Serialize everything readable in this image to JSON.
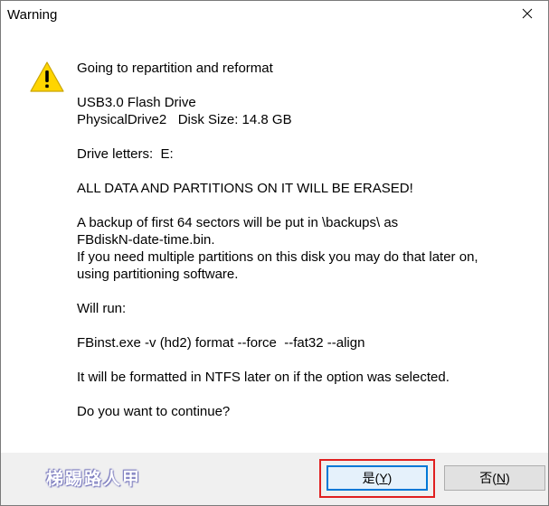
{
  "window": {
    "title": "Warning"
  },
  "icons": {
    "warning": "warning-icon",
    "close": "close-icon"
  },
  "colors": {
    "warning_yellow": "#ffd500",
    "highlight_red": "#e02020",
    "default_button_border": "#0078d7"
  },
  "message": {
    "line1": "Going to repartition and reformat",
    "line2": "USB3.0 Flash Drive",
    "line3": "PhysicalDrive2   Disk Size: 14.8 GB",
    "line4": "Drive letters:  E:",
    "line5": "ALL DATA AND PARTITIONS ON IT WILL BE ERASED!",
    "line6": "A backup of first 64 sectors will be put in \\backups\\ as",
    "line7": "FBdiskN-date-time.bin.",
    "line8": "If you need multiple partitions on this disk you may do that later on,",
    "line9": "using partitioning software.",
    "line10": "Will run:",
    "line11": "FBinst.exe -v (hd2) format --force  --fat32 --align",
    "line12": "It will be formatted in NTFS later on if the option was selected.",
    "line13": "Do you want to continue?"
  },
  "buttons": {
    "yes_label": "是(",
    "yes_mnemonic": "Y",
    "yes_suffix": ")",
    "no_label": "否(",
    "no_mnemonic": "N",
    "no_suffix": ")"
  },
  "watermark": {
    "text": "梯踢路人甲"
  }
}
